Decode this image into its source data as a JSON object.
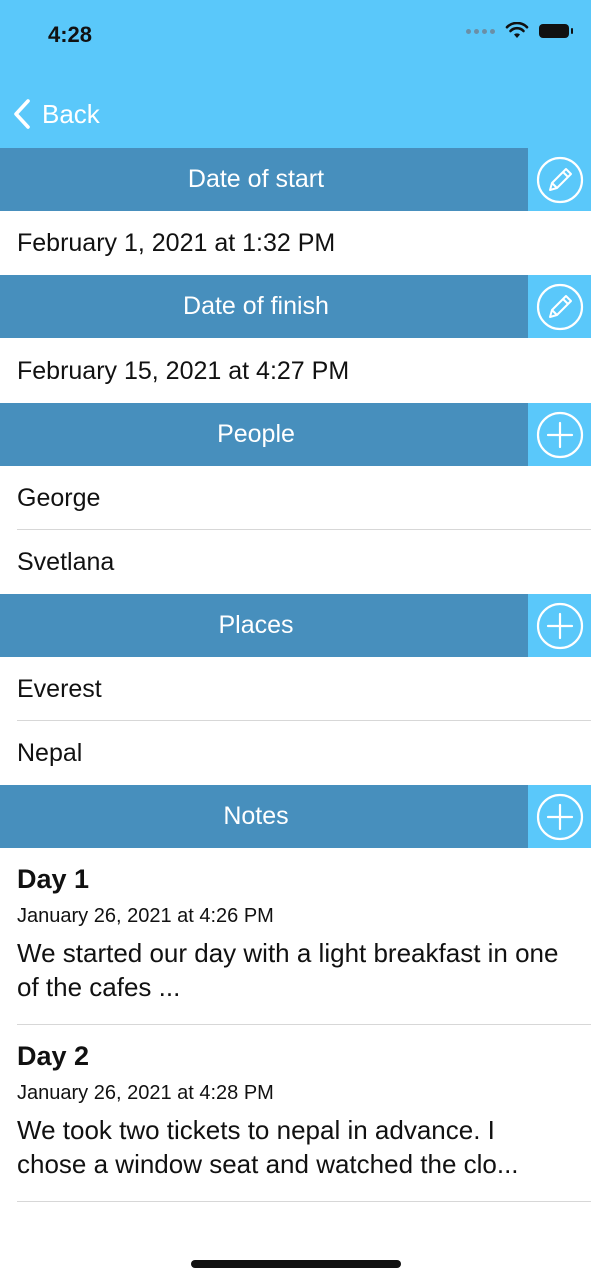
{
  "status_bar": {
    "time": "4:28"
  },
  "nav": {
    "back_label": "Back"
  },
  "sections": {
    "date_of_start": {
      "title": "Date of start",
      "value": "February 1, 2021 at 1:32 PM",
      "action_icon": "pencil-icon"
    },
    "date_of_finish": {
      "title": "Date of finish",
      "value": "February 15, 2021 at 4:27 PM",
      "action_icon": "pencil-icon"
    },
    "people": {
      "title": "People",
      "items": [
        "George",
        "Svetlana"
      ],
      "action_icon": "plus-icon"
    },
    "places": {
      "title": "Places",
      "items": [
        "Everest",
        "Nepal"
      ],
      "action_icon": "plus-icon"
    },
    "notes": {
      "title": "Notes",
      "action_icon": "plus-icon",
      "items": [
        {
          "title": "Day 1",
          "date": "January 26, 2021 at 4:26 PM",
          "text": "We started our day with a light breakfast in one of the cafes  ..."
        },
        {
          "title": "Day 2",
          "date": "January 26, 2021 at 4:28 PM",
          "text": "We took two tickets to nepal in advance. I chose a window seat and watched the clo..."
        }
      ]
    }
  },
  "colors": {
    "nav_background": "#5ac8fa",
    "section_header": "#478fbd",
    "action_button": "#5ac8fa"
  }
}
